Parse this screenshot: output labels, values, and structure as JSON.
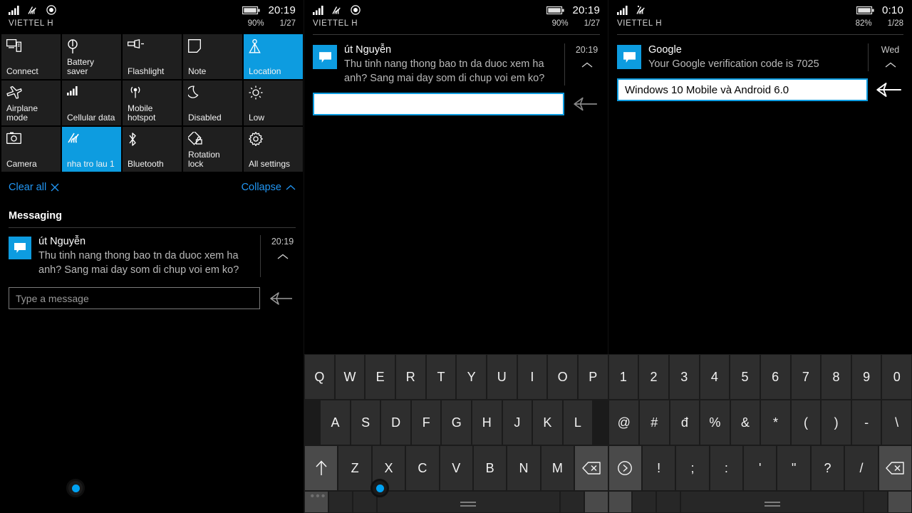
{
  "accent": "#0d9ce0",
  "panels": {
    "left": {
      "status": {
        "carrier": "VIETTEL H",
        "clock": "20:19",
        "battery": "90%",
        "date": "1/27"
      },
      "tiles": [
        {
          "label": "Connect",
          "icon": "connect-icon",
          "active": false
        },
        {
          "label": "Battery saver",
          "icon": "battery-saver-icon",
          "active": false
        },
        {
          "label": "Flashlight",
          "icon": "flashlight-icon",
          "active": false
        },
        {
          "label": "Note",
          "icon": "note-icon",
          "active": false
        },
        {
          "label": "Location",
          "icon": "location-icon",
          "active": true
        },
        {
          "label": "Airplane mode",
          "icon": "airplane-icon",
          "active": false
        },
        {
          "label": "Cellular data",
          "icon": "cellular-icon",
          "active": false
        },
        {
          "label": "Mobile hotspot",
          "icon": "hotspot-icon",
          "active": false
        },
        {
          "label": "Disabled",
          "icon": "moon-icon",
          "active": false
        },
        {
          "label": "Low",
          "icon": "brightness-icon",
          "active": false
        },
        {
          "label": "Camera",
          "icon": "camera-icon",
          "active": false
        },
        {
          "label": "nha tro lau 1",
          "icon": "wifi-icon",
          "active": true
        },
        {
          "label": "Bluetooth",
          "icon": "bluetooth-icon",
          "active": false
        },
        {
          "label": "Rotation lock",
          "icon": "rotation-lock-icon",
          "active": false
        },
        {
          "label": "All settings",
          "icon": "gear-icon",
          "active": false
        }
      ],
      "actions": {
        "clear_all": "Clear all",
        "collapse": "Collapse"
      },
      "group_title": "Messaging",
      "notification": {
        "title": "út Nguyễn",
        "text": "Thu tinh nang thong bao tn da duoc xem ha anh? Sang mai day som di chup voi em ko?",
        "time": "20:19"
      },
      "reply": {
        "placeholder": "Type a message",
        "value": ""
      }
    },
    "mid": {
      "status": {
        "carrier": "VIETTEL H",
        "clock": "20:19",
        "battery": "90%",
        "date": "1/27"
      },
      "notification": {
        "title": "út Nguyễn",
        "text": "Thu tinh nang thong bao tn da duoc xem ha anh? Sang mai day som di chup voi em ko?",
        "time": "20:19"
      },
      "reply": {
        "placeholder": "",
        "value": ""
      }
    },
    "right": {
      "status": {
        "carrier": "VIETTEL H",
        "clock": "0:10",
        "battery": "82%",
        "date": "1/28"
      },
      "notification": {
        "title": "Google",
        "text": "Your Google verification code is 7025",
        "time": "Wed"
      },
      "reply": {
        "placeholder": "",
        "value": "Windows 10 Mobile và Android 6.0"
      }
    }
  },
  "keyboard": {
    "row1": [
      "Q",
      "W",
      "E",
      "R",
      "T",
      "Y",
      "U",
      "I",
      "O",
      "P",
      "1",
      "2",
      "3",
      "4",
      "5",
      "6",
      "7",
      "8",
      "9",
      "0"
    ],
    "row2": [
      "A",
      "S",
      "D",
      "F",
      "G",
      "H",
      "J",
      "K",
      "L",
      "@",
      "#",
      "đ",
      "%",
      "&",
      "*",
      "(",
      ")",
      "-",
      "\\"
    ],
    "row3_left": [
      "↑",
      "Z",
      "X",
      "C",
      "V",
      "B",
      "N",
      "M",
      "⌫"
    ],
    "row3_right": [
      "＞",
      "!",
      ";",
      ":",
      "'",
      "\"",
      "?",
      "/",
      "⌫"
    ]
  }
}
